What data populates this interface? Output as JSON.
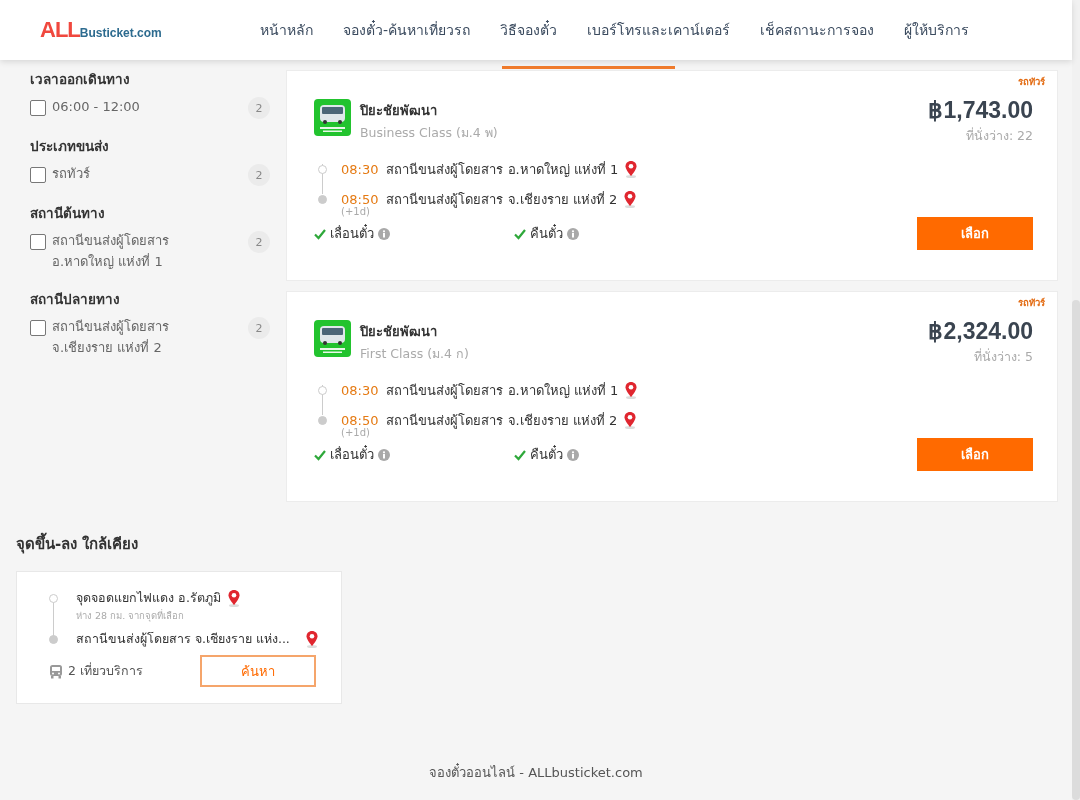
{
  "header": {
    "logo": {
      "brand": "ALL",
      "domain": "Busticket.com"
    },
    "nav": [
      {
        "label": "หน้าหลัก"
      },
      {
        "label": "จองตั๋ว-ค้นหาเที่ยวรถ"
      },
      {
        "label": "วิธีจองตั๋ว"
      },
      {
        "label": "เบอร์โทรและเคาน์เตอร์"
      },
      {
        "label": "เช็คสถานะการจอง"
      },
      {
        "label": "ผู้ให้บริการ"
      }
    ]
  },
  "filters": [
    {
      "title": "เวลาออกเดินทาง",
      "options": [
        {
          "label": "06:00 - 12:00",
          "count": "2",
          "checked": false
        }
      ]
    },
    {
      "title": "ประเภทขนส่ง",
      "options": [
        {
          "label": "รถทัวร์",
          "count": "2",
          "checked": false
        }
      ]
    },
    {
      "title": "สถานีต้นทาง",
      "options": [
        {
          "label": "สถานีขนส่งผู้โดยสาร อ.หาดใหญ่ แห่งที่ 1",
          "count": "2",
          "checked": false
        }
      ]
    },
    {
      "title": "สถานีปลายทาง",
      "options": [
        {
          "label": "สถานีขนส่งผู้โดยสาร จ.เชียงราย แห่งที่ 2",
          "count": "2",
          "checked": false
        }
      ]
    }
  ],
  "trips": [
    {
      "tag": "รถทัวร์",
      "operator": "ปิยะชัยพัฒนา",
      "class": "Business Class (ม.4 พ)",
      "price": "฿1,743.00",
      "seats": "ที่นั่งว่าง: 22",
      "stops": [
        {
          "time": "08:30",
          "station": "สถานีขนส่งผู้โดยสาร อ.หาดใหญ่ แห่งที่ 1"
        },
        {
          "time": "08:50",
          "station": "สถานีขนส่งผู้โดยสาร จ.เชียงราย แห่งที่ 2",
          "day_offset": "(+1d)"
        }
      ],
      "features": [
        {
          "label": "เลื่อนตั๋ว",
          "available": true
        },
        {
          "label": "คืนตั๋ว",
          "available": true
        }
      ],
      "button": "เลือก"
    },
    {
      "tag": "รถทัวร์",
      "operator": "ปิยะชัยพัฒนา",
      "class": "First Class (ม.4 ก)",
      "price": "฿2,324.00",
      "seats": "ที่นั่งว่าง: 5",
      "stops": [
        {
          "time": "08:30",
          "station": "สถานีขนส่งผู้โดยสาร อ.หาดใหญ่ แห่งที่ 1"
        },
        {
          "time": "08:50",
          "station": "สถานีขนส่งผู้โดยสาร จ.เชียงราย แห่งที่ 2",
          "day_offset": "(+1d)"
        }
      ],
      "features": [
        {
          "label": "เลื่อนตั๋ว",
          "available": true
        },
        {
          "label": "คืนตั๋ว",
          "available": true
        }
      ],
      "button": "เลือก"
    }
  ],
  "nearby": {
    "title": "จุดขึ้น-ลง ใกล้เคียง",
    "stops": [
      {
        "name": "จุดจอดแยกไฟแดง อ.รัตภูมิ",
        "note": "ห่าง 28 กม. จากจุดที่เลือก"
      },
      {
        "name": "สถานีขนส่งผู้โดยสาร จ.เชียงราย แห่ง..."
      }
    ],
    "trips": "2 เที่ยวบริการ",
    "button": "ค้นหา"
  },
  "footer": "จองตั๋วออนไลน์ - ALLbusticket.com"
}
